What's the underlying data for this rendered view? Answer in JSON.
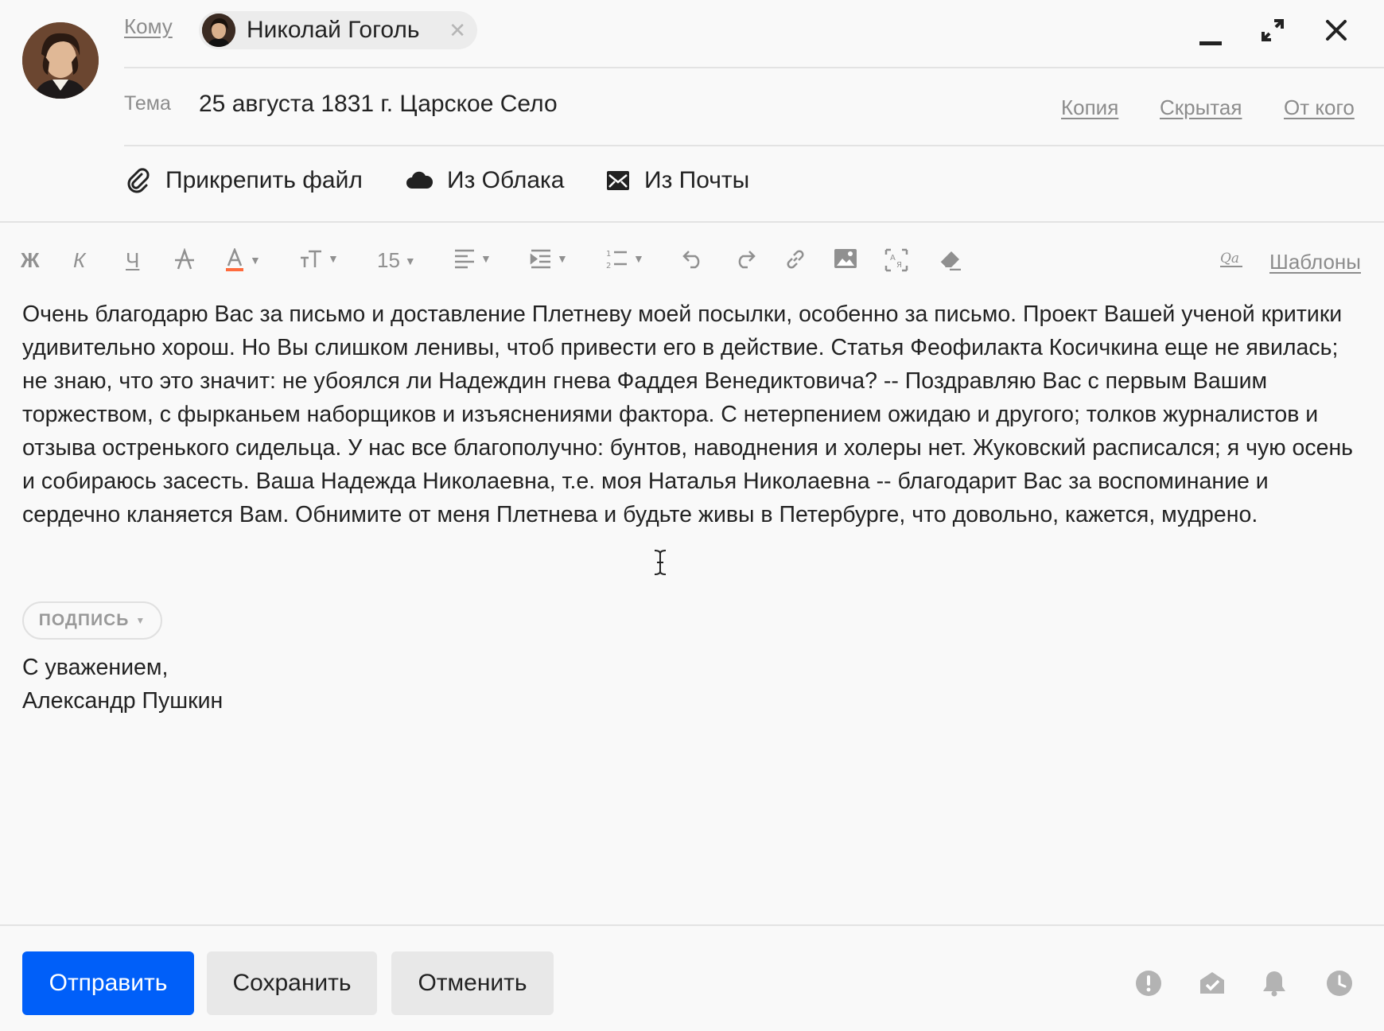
{
  "recipient": {
    "to_label": "Кому",
    "name": "Николай Гоголь",
    "remove": "✕"
  },
  "subject": {
    "label": "Тема",
    "value": "25 августа 1831 г. Царское Село"
  },
  "header_links": {
    "cc": "Копия",
    "bcc": "Скрытая",
    "from": "От кого"
  },
  "attach": {
    "file": "Прикрепить файл",
    "cloud": "Из Облака",
    "mail": "Из Почты"
  },
  "toolbar": {
    "bold": "Ж",
    "italic": "К",
    "underline": "Ч",
    "font_size": "15",
    "templates": "Шаблоны",
    "text_color": "#ff6b3d"
  },
  "body": {
    "text": "Очень благодарю Вас за письмо и доставление Плетневу моей посылки, особенно за письмо. Проект Вашей ученой критики удивительно хорош. Но Вы слишком ленивы, чтоб привести его в действие. Статья Феофилакта Косичкина еще не явилась; не знаю, что это значит: не убоялся ли Надеждин гнева Фаддея Венедиктовича? -- Поздравляю Вас с первым Вашим торжеством, с фырканьем наборщиков и изъяснениями фактора. С нетерпением ожидаю и другого; толков журналистов и отзыва остренького сидельца. У нас все благополучно: бунтов, наводнения и холеры нет. Жуковский расписался; я чую осень и собираюсь засесть. Ваша Надежда Николаевна, т.е. моя Наталья Николаевна -- благодарит Вас за воспоминание и сердечно кланяется Вам. Обнимите от меня Плетнева и будьте живы в Петербурге, что довольно, кажется, мудрено."
  },
  "signature": {
    "button": "ПОДПИСЬ",
    "line1": "С уважением,",
    "line2": "Александр Пушкин"
  },
  "footer": {
    "send": "Отправить",
    "save": "Сохранить",
    "cancel": "Отменить",
    "send_color": "#005ff9"
  }
}
